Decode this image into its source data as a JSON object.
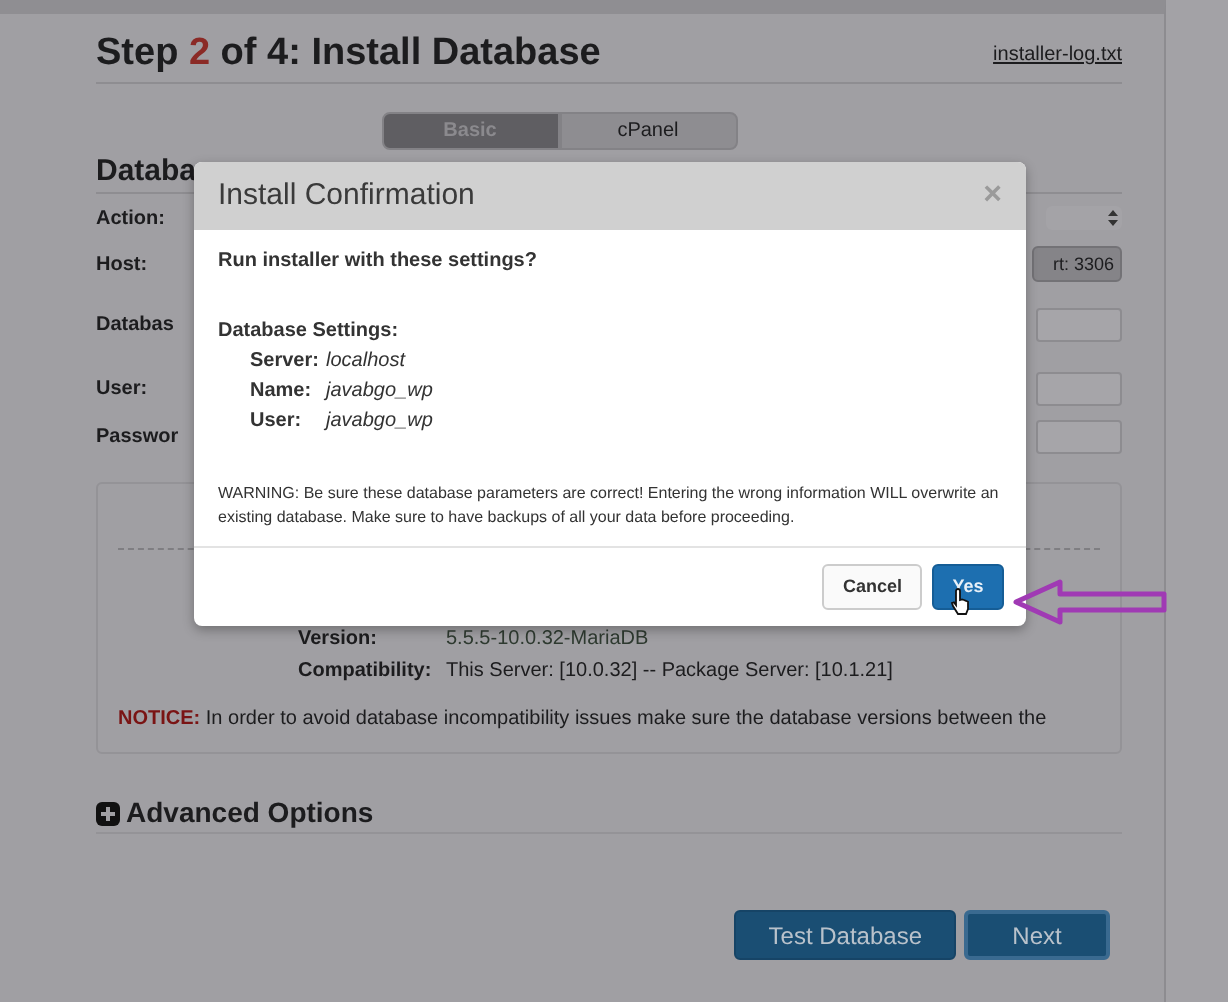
{
  "page": {
    "title": {
      "before": "Step ",
      "step": "2",
      "after": " of 4: Install Database"
    },
    "log_link": "installer-log.txt",
    "mode_tabs": [
      {
        "label": "Basic",
        "selected": true
      },
      {
        "label": "cPanel",
        "selected": false
      }
    ],
    "section_heading": "Databa",
    "form_rows": [
      {
        "label": "Action:",
        "kind": "select"
      },
      {
        "label": "Host:",
        "kind": "port",
        "value": "rt: 3306"
      },
      {
        "label": "Databas",
        "kind": "input"
      },
      {
        "label": "User:",
        "kind": "input"
      },
      {
        "label": "Passwor",
        "kind": "input"
      }
    ],
    "server_info": [
      {
        "label": "Version:",
        "value": "5.5.5-10.0.32-MariaDB"
      },
      {
        "label": "Compatibility:",
        "value": "This Server: [10.0.32] -- Package Server: [10.1.21]"
      }
    ],
    "notice": {
      "label": "NOTICE:",
      "text": "In order to avoid database incompatibility issues make sure the database versions between the"
    },
    "advanced_options": {
      "label": "Advanced Options",
      "expanded": false
    },
    "buttons": [
      "Test Database",
      "Next"
    ]
  },
  "dialog": {
    "title": "Install Confirmation",
    "close": "×",
    "question": "Run installer with these settings?",
    "settings_heading": "Database Settings:",
    "settings": [
      {
        "label": "Server:",
        "value": "localhost"
      },
      {
        "label": "Name:",
        "value": "javabgo_wp"
      },
      {
        "label": "User:",
        "value": "javabgo_wp"
      }
    ],
    "warning": "WARNING: Be sure these database parameters are correct! Entering the wrong information WILL overwrite an existing database. Make sure to have backups of all your data before proceeding.",
    "buttons": [
      {
        "label": "Cancel",
        "kind": "secondary"
      },
      {
        "label": "Yes",
        "kind": "primary"
      }
    ]
  }
}
